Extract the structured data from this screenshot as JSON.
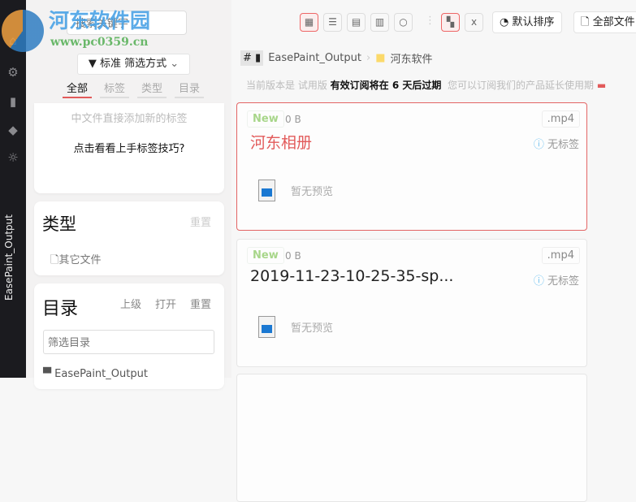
{
  "watermark": {
    "title": "河东软件园",
    "url": "www.pc0359.cn"
  },
  "rail": {
    "label": "EasePaint_Output"
  },
  "left": {
    "search_placeholder": "搜索关键字",
    "filter_label": "标准 筛选方式",
    "tabs": [
      "全部",
      "标签",
      "类型",
      "目录"
    ],
    "tag_hint": "中文件直接添加新的标签",
    "tag_tip": "点击看看上手标签技巧?",
    "type": {
      "title": "类型",
      "reset": "重置",
      "items": [
        "其它文件"
      ]
    },
    "dir": {
      "title": "目录",
      "up": "上级",
      "open": "打开",
      "reset": "重置",
      "filter_placeholder": "筛选目录",
      "items": [
        "EasePaint_Output"
      ]
    }
  },
  "toolbar": {
    "sort": "默认排序",
    "all_files": "全部文件"
  },
  "breadcrumb": {
    "hash": "#",
    "root": "EasePaint_Output",
    "folder": "河东软件"
  },
  "notice": {
    "pre": "当前版本是 试用版",
    "bold": "有效订阅将在 6 天后过期",
    "post": "您可以订阅我们的产品延长使用期"
  },
  "files": [
    {
      "badge": "New",
      "size": "0 B",
      "ext": ".mp4",
      "name": "河东相册",
      "tags": "无标签",
      "preview": "暂无预览"
    },
    {
      "badge": "New",
      "size": "0 B",
      "ext": ".mp4",
      "name": "2019-11-23-10-25-35-sp...",
      "tags": "无标签",
      "preview": "暂无预览"
    }
  ],
  "colors": {
    "accent": "#e25a5a",
    "rail": "#1b1b1f",
    "new": "#a8d68a"
  }
}
